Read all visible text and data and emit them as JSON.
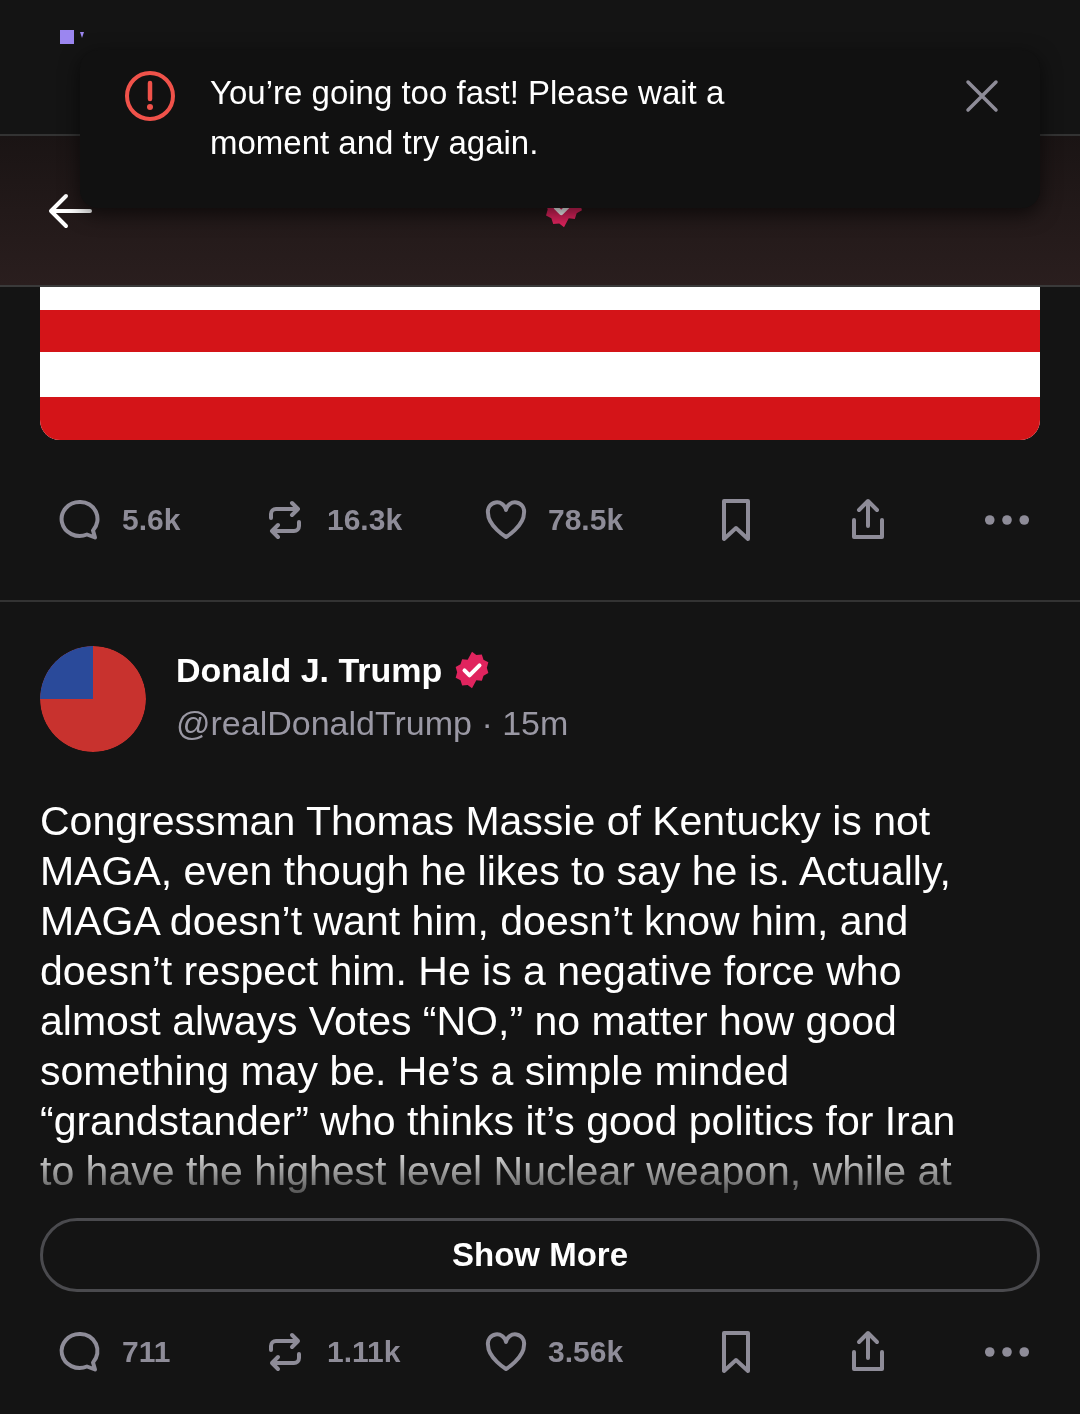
{
  "toast": {
    "message": "You’re going too fast! Please wait a moment and try again."
  },
  "header": {
    "verified": true
  },
  "posts": [
    {
      "actions": {
        "replies": "5.6k",
        "reposts": "16.3k",
        "likes": "78.5k"
      }
    },
    {
      "author": {
        "name": "Donald J. Trump",
        "verified": true,
        "handle": "@realDonaldTrump",
        "separator": "·",
        "time": "15m"
      },
      "text": "Congressman Thomas Massie of Kentucky is not MAGA, even though he likes to say he is. Actually, MAGA doesn’t want him, doesn’t know him, and doesn’t respect him. He is a negative force who almost always Votes “NO,” no matter how good something may be. He’s a simple minded “grandstander” who thinks it’s good politics for Iran to have the highest level Nuclear weapon, while at",
      "show_more": "Show More",
      "actions": {
        "replies": "711",
        "reposts": "1.11k",
        "likes": "3.56k"
      }
    }
  ]
}
